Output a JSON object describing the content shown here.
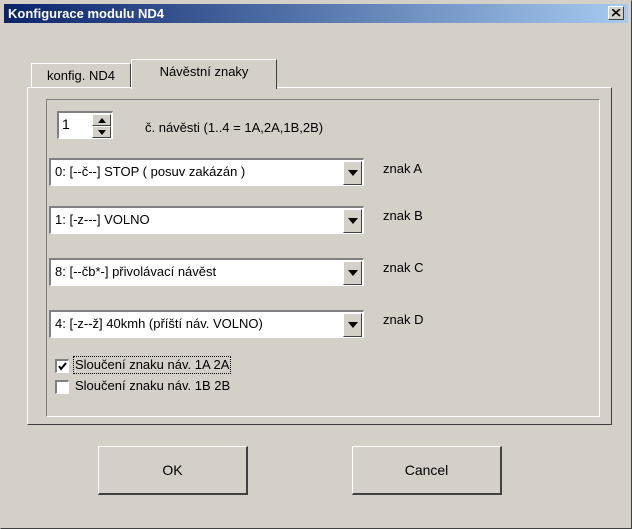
{
  "window": {
    "title": "Konfigurace modulu ND4"
  },
  "tabs": [
    {
      "label": "konfig. ND4",
      "active": false
    },
    {
      "label": "Návěstní znaky",
      "active": true
    }
  ],
  "signal": {
    "number_value": "1",
    "range_label": "č. návěsti (1..4 =  1A,2A,1B,2B)"
  },
  "combos": [
    {
      "value": "0:  [--č--]  STOP    ( posuv zakázán )",
      "label": "znak A"
    },
    {
      "value": "1:  [-z---]  VOLNO",
      "label": "znak B"
    },
    {
      "value": "8:  [--čb*-] přivolávací návěst",
      "label": "znak C"
    },
    {
      "value": "4:  [-z--ž] 40kmh (příští náv. VOLNO)",
      "label": "znak D"
    }
  ],
  "checks": [
    {
      "label": "Sloučení  znaku náv. 1A 2A",
      "checked": true
    },
    {
      "label": "Sloučení  znaku náv. 1B 2B",
      "checked": false
    }
  ],
  "buttons": {
    "ok": "OK",
    "cancel": "Cancel"
  },
  "icons": {
    "close": "close-icon",
    "spin": "spin-arrows-icon",
    "dropdown": "chevron-down-icon",
    "checkmark": "checkmark-icon"
  }
}
